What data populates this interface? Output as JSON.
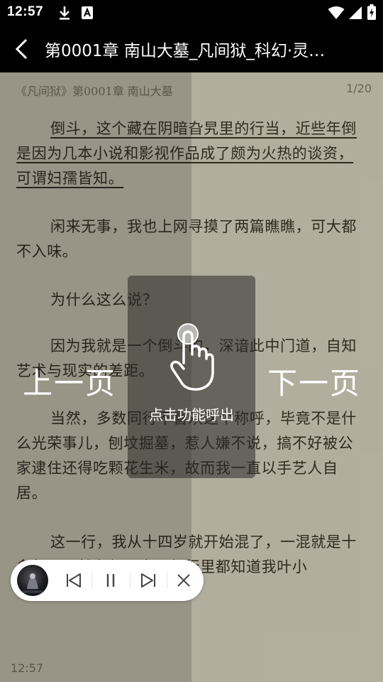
{
  "status_bar": {
    "time": "12:57",
    "icons": [
      "download-icon",
      "font-a-icon",
      "wifi-icon",
      "signal-icon",
      "battery-charging-icon"
    ]
  },
  "top_bar": {
    "back_icon": "chevron-left-icon",
    "title": "第0001章 南山大墓_凡间狱_科幻·灵…"
  },
  "reader": {
    "header": "《凡间狱》第0001章 南山大墓",
    "page_indicator": "1/20",
    "paragraphs": [
      "倒斗，这个藏在阴暗旮旯里的行当，近些年倒是因为几本小说和影视作品成了颇为火热的谈资，可谓妇孺皆知。",
      "闲来无事，我也上网寻摸了两篇瞧瞧，可大都不入味。",
      "为什么这么说？",
      "因为我就是一个倒斗的，深谙此中门道，自知艺术与现实的差距。",
      "当然，多数同行不喜欢这个称呼，毕竟不是什么光荣事儿，刨坟掘墓，惹人嫌不说，搞不好被公家逮住还得吃颗花生米，故而我一直以手艺人自居。",
      "这一行，我从十四岁就开始混了，一混就是十多年，虽然名气不大，但行里都知道我叶小"
    ],
    "clock": "12:57"
  },
  "overlay": {
    "prev_page": "上一页",
    "next_page": "下一页",
    "tip": "点击功能呼出",
    "tip_icon": "tap-hand-icon"
  },
  "audio_player": {
    "cover_icon": "album-cover",
    "controls": [
      "skip-previous-icon",
      "pause-icon",
      "skip-next-icon",
      "close-icon"
    ]
  },
  "colors": {
    "page_bg": "#dad5c1",
    "text": "#3a3327",
    "bar_bg": "#000000"
  }
}
